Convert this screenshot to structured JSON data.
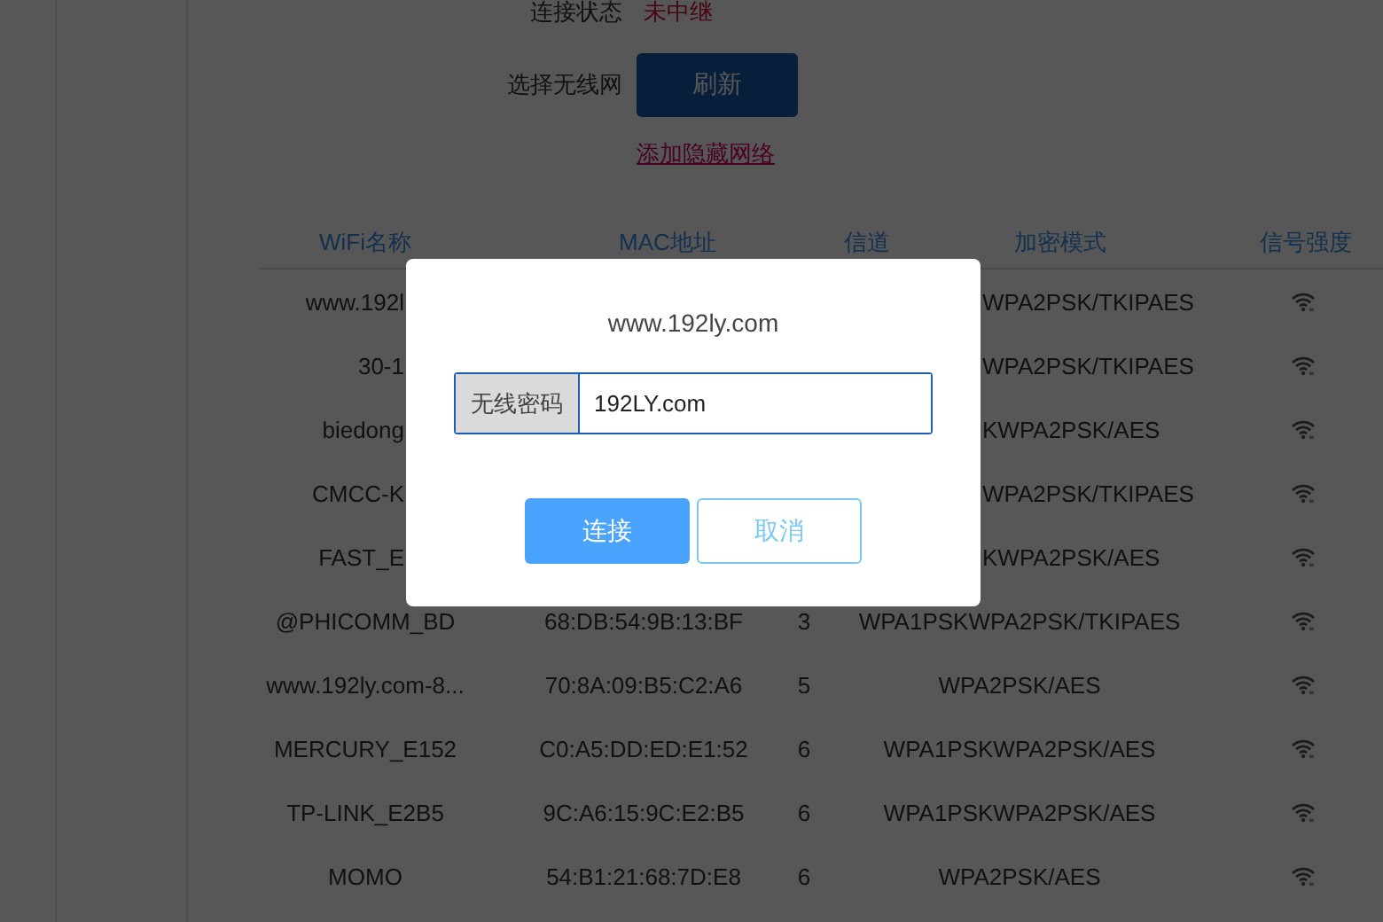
{
  "status": {
    "label": "连接状态",
    "value": "未中继"
  },
  "wireless": {
    "label": "选择无线网",
    "refresh_button": "刷新",
    "hidden_network_link": "添加隐藏网络"
  },
  "table": {
    "columns": [
      "WiFi名称",
      "MAC地址",
      "信道",
      "加密模式",
      "信号强度"
    ],
    "rows": [
      {
        "covered": true,
        "name": "www.192l",
        "encryption": "WPA2PSK/TKIPAES"
      },
      {
        "covered": true,
        "name": "30-1",
        "encryption": "WPA2PSK/TKIPAES"
      },
      {
        "covered": true,
        "name": "biedong",
        "encryption": "KWPA2PSK/AES"
      },
      {
        "covered": true,
        "name": "CMCC-K",
        "encryption": "WPA2PSK/TKIPAES"
      },
      {
        "covered": true,
        "name": "FAST_E",
        "encryption": "KWPA2PSK/AES"
      },
      {
        "covered": false,
        "name": "@PHICOMM_BD",
        "mac": "68:DB:54:9B:13:BF",
        "channel": "3",
        "encryption": "WPA1PSKWPA2PSK/TKIPAES"
      },
      {
        "covered": false,
        "name": "www.192ly.com-8...",
        "mac": "70:8A:09:B5:C2:A6",
        "channel": "5",
        "encryption": "WPA2PSK/AES"
      },
      {
        "covered": false,
        "name": "MERCURY_E152",
        "mac": "C0:A5:DD:ED:E1:52",
        "channel": "6",
        "encryption": "WPA1PSKWPA2PSK/AES"
      },
      {
        "covered": false,
        "name": "TP-LINK_E2B5",
        "mac": "9C:A6:15:9C:E2:B5",
        "channel": "6",
        "encryption": "WPA1PSKWPA2PSK/AES"
      },
      {
        "covered": false,
        "name": "MOMO",
        "mac": "54:B1:21:68:7D:E8",
        "channel": "6",
        "encryption": "WPA2PSK/AES"
      }
    ]
  },
  "dialog": {
    "title": "www.192ly.com",
    "field_label": "无线密码",
    "field_value": "192LY.com",
    "buttons": [
      {
        "kind": "primary",
        "label": "连接"
      },
      {
        "kind": "secondary",
        "label": "取消"
      }
    ]
  }
}
